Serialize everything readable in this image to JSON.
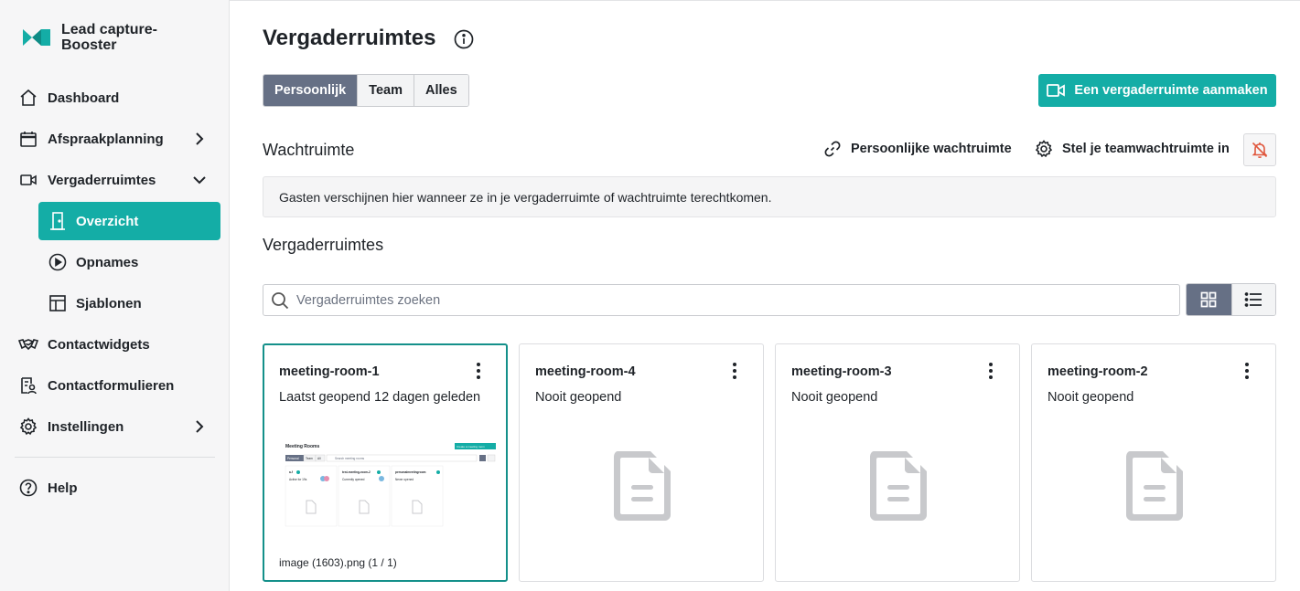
{
  "app": {
    "name": "Lead capture-Booster",
    "accent": "#14ada6"
  },
  "sidebar": {
    "items": [
      {
        "label": "Dashboard",
        "icon": "home-icon"
      },
      {
        "label": "Afspraakplanning",
        "icon": "calendar-icon",
        "chevron": "chevron-right-icon"
      },
      {
        "label": "Vergaderruimtes",
        "icon": "video-icon",
        "chevron": "chevron-down-icon",
        "expanded": true
      },
      {
        "label": "Overzicht",
        "icon": "door-icon",
        "active": true
      },
      {
        "label": "Opnames",
        "icon": "play-circle-icon"
      },
      {
        "label": "Sjablonen",
        "icon": "layout-icon"
      },
      {
        "label": "Contactwidgets",
        "icon": "handshake-icon"
      },
      {
        "label": "Contactformulieren",
        "icon": "form-icon"
      },
      {
        "label": "Instellingen",
        "icon": "gear-icon",
        "chevron": "chevron-right-icon"
      },
      {
        "label": "Help",
        "icon": "help-icon"
      }
    ]
  },
  "header": {
    "title": "Vergaderruimtes",
    "filter_tabs": [
      {
        "label": "Persoonlijk",
        "active": true
      },
      {
        "label": "Team",
        "active": false
      },
      {
        "label": "Alles",
        "active": false
      }
    ],
    "create_button": "Een vergaderruimte aanmaken"
  },
  "waiting_room": {
    "title": "Wachtruimte",
    "personal_link": "Persoonlijke wachtruimte",
    "team_setup": "Stel je teamwachtruimte in",
    "empty_text": "Gasten verschijnen hier wanneer ze in je vergaderruimte of wachtruimte terechtkomen."
  },
  "rooms": {
    "title": "Vergaderruimtes",
    "search_placeholder": "Vergaderruimtes zoeken",
    "view_mode": "grid",
    "cards": [
      {
        "name": "meeting-room-1",
        "status": "Laatst geopend 12 dagen geleden",
        "filename": "image (1603).png (1 / 1)",
        "selected": true,
        "thumb": {
          "title": "Meeting Rooms",
          "button": "Create a meeting room",
          "tabs": [
            "Personal",
            "Team",
            "All"
          ],
          "search": "Search meeting rooms",
          "cards": [
            {
              "name": "a-f",
              "status": "Active for 19s"
            },
            {
              "name": "test-meeting-room-2",
              "status": "Currently opened"
            },
            {
              "name": "personalmeetingroom",
              "status": "Never opened"
            }
          ]
        }
      },
      {
        "name": "meeting-room-4",
        "status": "Nooit geopend"
      },
      {
        "name": "meeting-room-3",
        "status": "Nooit geopend"
      },
      {
        "name": "meeting-room-2",
        "status": "Nooit geopend"
      }
    ]
  }
}
